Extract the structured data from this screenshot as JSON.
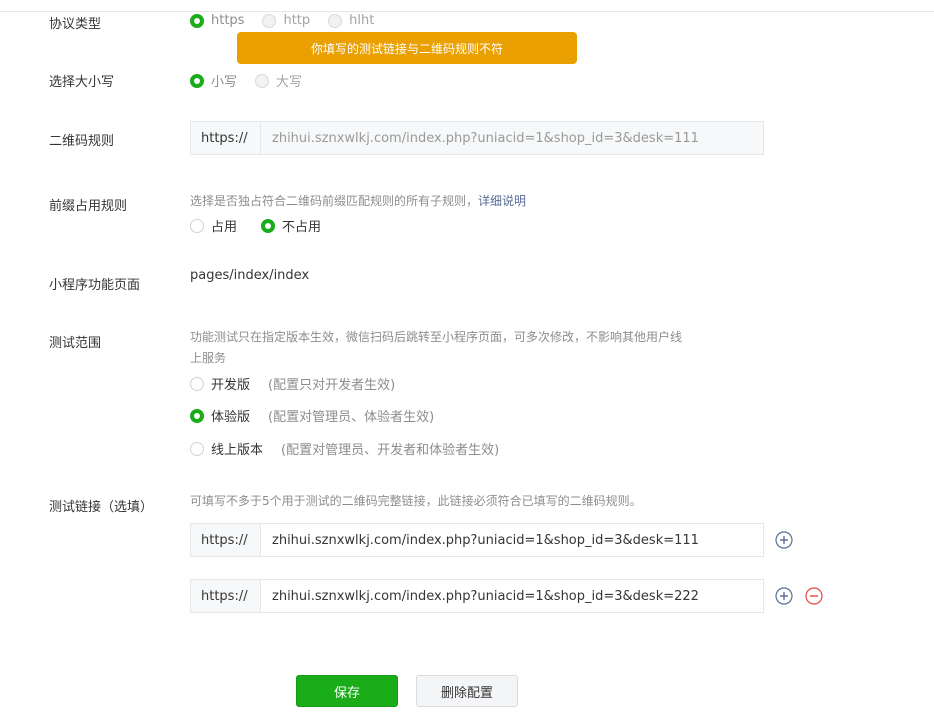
{
  "protocol": {
    "label": "协议类型",
    "options": [
      "https",
      "http",
      "hlht"
    ],
    "selected": "https"
  },
  "tip_message": "你填写的测试链接与二维码规则不符",
  "case": {
    "label": "选择大小写",
    "options": [
      "小写",
      "大写"
    ],
    "selected": "小写"
  },
  "qr_rule": {
    "label": "二维码规则",
    "prefix": "https://",
    "value": "zhihui.sznxwlkj.com/index.php?uniacid=1&shop_id=3&desk=111"
  },
  "prefix_rule": {
    "label": "前缀占用规则",
    "description": "选择是否独占符合二维码前缀匹配规则的所有子规则，",
    "link": "详细说明",
    "options": [
      "占用",
      "不占用"
    ],
    "selected": "不占用"
  },
  "page": {
    "label": "小程序功能页面",
    "value": "pages/index/index"
  },
  "test_scope": {
    "label": "测试范围",
    "description_line1": "功能测试只在指定版本生效，微信扫码后跳转至小程序页面，可多次修改，不影响其他用户线",
    "description_line2": "上服务",
    "options": [
      {
        "name": "开发版",
        "note": "(配置只对开发者生效)"
      },
      {
        "name": "体验版",
        "note": "(配置对管理员、体验者生效)"
      },
      {
        "name": "线上版本",
        "note": "(配置对管理员、开发者和体验者生效)"
      }
    ],
    "selected": "体验版"
  },
  "test_links": {
    "label": "测试链接（选填）",
    "description": "可填写不多于5个用于测试的二维码完整链接，此链接必须符合已填写的二维码规则。",
    "prefix": "https://",
    "links": [
      "zhihui.sznxwlkj.com/index.php?uniacid=1&shop_id=3&desk=111",
      "zhihui.sznxwlkj.com/index.php?uniacid=1&shop_id=3&desk=222"
    ]
  },
  "actions": {
    "save": "保存",
    "delete": "删除配置"
  },
  "colors": {
    "primary": "#1aad19",
    "warning": "#eaa000",
    "danger": "#e64340",
    "link": "#576b95"
  },
  "icons": {
    "add": "plus-circle-icon",
    "remove": "minus-circle-icon"
  }
}
